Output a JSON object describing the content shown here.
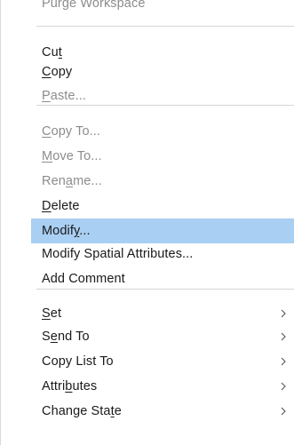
{
  "menu": {
    "clipped_item": "Purge Workspace",
    "items": [
      {
        "before": "Cu",
        "key": "t",
        "after": "",
        "disabled": false,
        "submenu": false
      },
      {
        "before": "",
        "key": "C",
        "after": "opy",
        "disabled": false,
        "submenu": false
      },
      {
        "before": "",
        "key": "P",
        "after": "aste...",
        "disabled": true,
        "submenu": false
      },
      {
        "before": "",
        "key": "C",
        "after": "opy To...",
        "disabled": true,
        "submenu": false
      },
      {
        "before": "",
        "key": "M",
        "after": "ove To...",
        "disabled": true,
        "submenu": false
      },
      {
        "before": "Ren",
        "key": "a",
        "after": "me...",
        "disabled": true,
        "submenu": false
      },
      {
        "before": "",
        "key": "D",
        "after": "elete",
        "disabled": false,
        "submenu": false
      },
      {
        "before": "Modif",
        "key": "y",
        "after": "...",
        "disabled": false,
        "submenu": false,
        "highlighted": true
      },
      {
        "before": "Modify Spatial Attributes...",
        "key": "",
        "after": "",
        "disabled": false,
        "submenu": false
      },
      {
        "before": "Add Comment",
        "key": "",
        "after": "",
        "disabled": false,
        "submenu": false
      },
      {
        "before": "",
        "key": "S",
        "after": "et",
        "disabled": false,
        "submenu": true
      },
      {
        "before": "S",
        "key": "e",
        "after": "nd To",
        "disabled": false,
        "submenu": true
      },
      {
        "before": "Copy List To",
        "key": "",
        "after": "",
        "disabled": false,
        "submenu": true
      },
      {
        "before": "Attri",
        "key": "b",
        "after": "utes",
        "disabled": false,
        "submenu": true
      },
      {
        "before": "Change Sta",
        "key": "t",
        "after": "e",
        "disabled": false,
        "submenu": true
      }
    ]
  },
  "colors": {
    "highlight": "#a9cff3",
    "disabled_text": "#8c8c8c",
    "separator": "#d6d6d6"
  }
}
